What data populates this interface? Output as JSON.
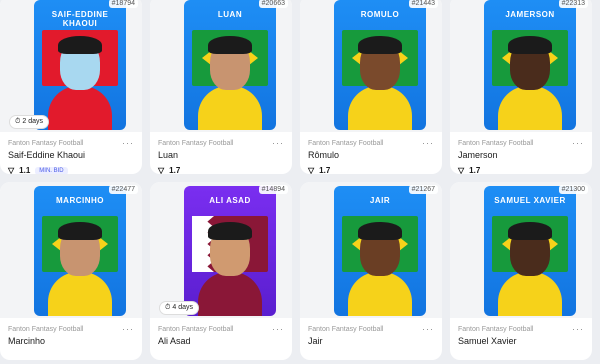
{
  "cards": [
    {
      "name": "SAIF-EDDINE KHAOUI",
      "collection": "Fanton Fantasy Football",
      "title": "Saif-Eddine Khaoui",
      "price": "1.1",
      "listing": "18794",
      "badge": "2 days",
      "chip": "MIN. BID",
      "theme": "blue",
      "flag": "tn",
      "skin": "#a8d8f0",
      "shirt": "#e21a2c"
    },
    {
      "name": "LUAN",
      "collection": "Fanton Fantasy Football",
      "title": "Luan",
      "price": "1.7",
      "listing": "20663",
      "badge": "",
      "chip": "",
      "theme": "blue",
      "flag": "br",
      "skin": "#c89470",
      "shirt": "#f6d21a"
    },
    {
      "name": "ROMULO",
      "collection": "Fanton Fantasy Football",
      "title": "Rômulo",
      "price": "1.7",
      "listing": "21443",
      "badge": "",
      "chip": "",
      "theme": "blue",
      "flag": "br",
      "skin": "#7a4a2c",
      "shirt": "#f6d21a"
    },
    {
      "name": "JAMERSON",
      "collection": "Fanton Fantasy Football",
      "title": "Jamerson",
      "price": "1.7",
      "listing": "22313",
      "badge": "",
      "chip": "",
      "theme": "blue",
      "flag": "br",
      "skin": "#4a2c1c",
      "shirt": "#f6d21a"
    },
    {
      "name": "MARCINHO",
      "collection": "Fanton Fantasy Football",
      "title": "Marcinho",
      "price": "",
      "listing": "22477",
      "badge": "",
      "chip": "",
      "theme": "blue",
      "flag": "br",
      "skin": "#c89470",
      "shirt": "#f6d21a"
    },
    {
      "name": "ALI ASAD",
      "collection": "Fanton Fantasy Football",
      "title": "Ali Asad",
      "price": "",
      "listing": "14894",
      "badge": "4 days",
      "chip": "",
      "theme": "purple",
      "flag": "qa",
      "skin": "#d09a70",
      "shirt": "#8a1737"
    },
    {
      "name": "JAIR",
      "collection": "Fanton Fantasy Football",
      "title": "Jair",
      "price": "",
      "listing": "21267",
      "badge": "",
      "chip": "",
      "theme": "blue",
      "flag": "br",
      "skin": "#6a3e24",
      "shirt": "#f6d21a"
    },
    {
      "name": "SAMUEL XAVIER",
      "collection": "Fanton Fantasy Football",
      "title": "Samuel Xavier",
      "price": "",
      "listing": "21300",
      "badge": "",
      "chip": "",
      "theme": "blue",
      "flag": "br",
      "skin": "#4a2c1c",
      "shirt": "#f6d21a"
    }
  ],
  "icons": {
    "ton": "diamond-icon",
    "clock": "clock-icon",
    "more": "more-dots-icon"
  },
  "currency_glyph": "▽",
  "listing_prefix": "#"
}
